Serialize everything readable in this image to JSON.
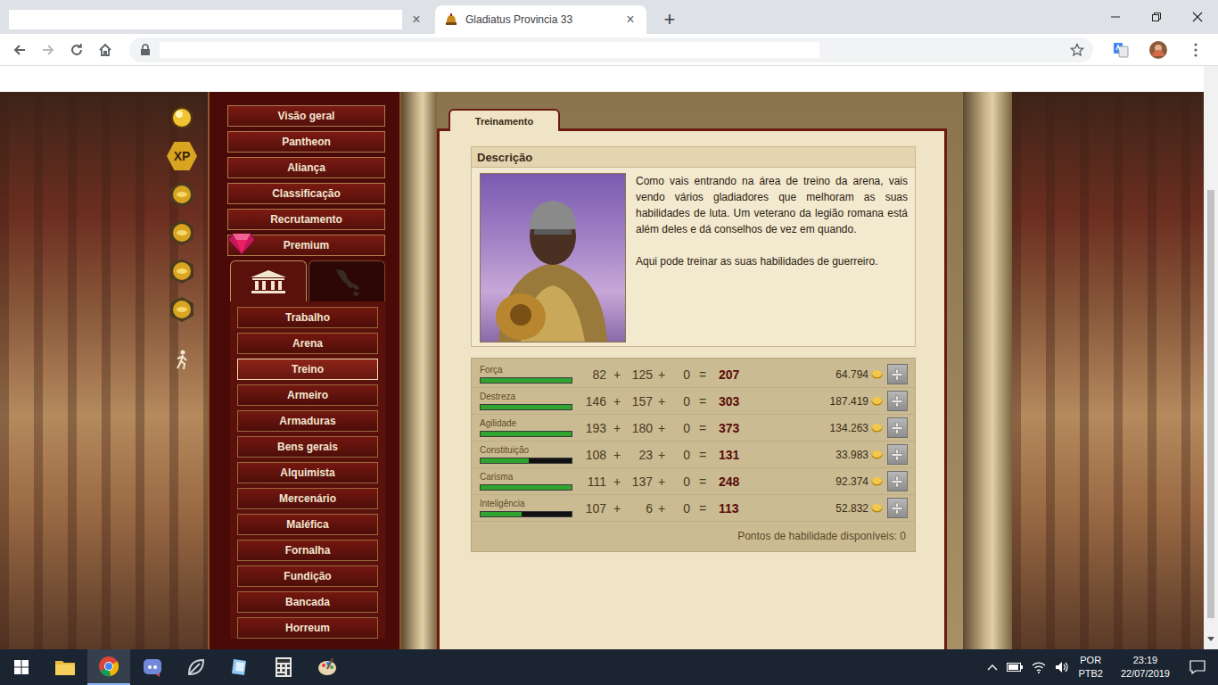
{
  "browser": {
    "tabs": [
      {
        "title": "",
        "selected": false,
        "close": "×"
      },
      {
        "title": "Gladiatus Provincia 33",
        "selected": true,
        "close": "×"
      }
    ],
    "new_tab": "+",
    "address": {
      "url": ""
    }
  },
  "game": {
    "side_icons": [
      {
        "kind": "orb",
        "label": ""
      },
      {
        "kind": "xp",
        "label": "XP"
      },
      {
        "kind": "coin",
        "label": ""
      },
      {
        "kind": "coin",
        "label": ""
      },
      {
        "kind": "coin",
        "label": ""
      },
      {
        "kind": "coin",
        "label": ""
      },
      {
        "kind": "walker",
        "label": ""
      }
    ],
    "menu": [
      {
        "label": "Visão geral",
        "kind": "link",
        "selected": false
      },
      {
        "label": "Pantheon",
        "kind": "link",
        "selected": false
      },
      {
        "label": "Aliança",
        "kind": "link",
        "selected": false
      },
      {
        "label": "Classificação",
        "kind": "link",
        "selected": false
      },
      {
        "label": "Recrutamento",
        "kind": "link",
        "selected": false
      },
      {
        "label": "Premium",
        "kind": "premium",
        "selected": false
      }
    ],
    "section_tabs": [
      {
        "kind": "city",
        "selected": true
      },
      {
        "kind": "map",
        "selected": false
      }
    ],
    "sub_menu": [
      {
        "label": "Trabalho",
        "selected": false
      },
      {
        "label": "Arena",
        "selected": false
      },
      {
        "label": "Treino",
        "selected": true
      },
      {
        "label": "Armeiro",
        "selected": false
      },
      {
        "label": "Armaduras",
        "selected": false
      },
      {
        "label": "Bens gerais",
        "selected": false
      },
      {
        "label": "Alquimista",
        "selected": false
      },
      {
        "label": "Mercenário",
        "selected": false
      },
      {
        "label": "Maléfica",
        "selected": false
      },
      {
        "label": "Fornalha",
        "selected": false
      },
      {
        "label": "Fundição",
        "selected": false
      },
      {
        "label": "Bancada",
        "selected": false
      },
      {
        "label": "Horreum",
        "selected": false
      }
    ],
    "panel": {
      "tab": "Treinamento",
      "description": {
        "title": "Descrição",
        "paragraphs": [
          "Como vais entrando na área de treino da arena, vais vendo vários gladiadores que melhoram as suas habilidades de luta. Um veterano da legião romana está além deles e dá conselhos de vez em quando.",
          "Aqui pode treinar as suas habilidades de guerreiro."
        ]
      },
      "operators": {
        "plus": "+",
        "equals": "="
      },
      "stats": [
        {
          "name": "Força",
          "base": "82",
          "bonus": "125",
          "extra": "0",
          "total": "207",
          "cost": "64.794",
          "level": 1
        },
        {
          "name": "Destreza",
          "base": "146",
          "bonus": "157",
          "extra": "0",
          "total": "303",
          "cost": "187.419",
          "level": 1
        },
        {
          "name": "Agilidade",
          "base": "193",
          "bonus": "180",
          "extra": "0",
          "total": "373",
          "cost": "134.263",
          "level": 1
        },
        {
          "name": "Constituição",
          "base": "108",
          "bonus": "23",
          "extra": "0",
          "total": "131",
          "cost": "33.983",
          "level": 0.53
        },
        {
          "name": "Carisma",
          "base": "111",
          "bonus": "137",
          "extra": "0",
          "total": "248",
          "cost": "92.374",
          "level": 1
        },
        {
          "name": "Inteligência",
          "base": "107",
          "bonus": "6",
          "extra": "0",
          "total": "113",
          "cost": "52.832",
          "level": 0.45
        }
      ],
      "footer": "Pontos de habilidade disponíveis: 0"
    }
  },
  "taskbar": {
    "apps": [
      {
        "kind": "folder",
        "selected": false
      },
      {
        "kind": "chrome",
        "selected": true
      },
      {
        "kind": "discord",
        "selected": false
      },
      {
        "kind": "leaf",
        "selected": false
      },
      {
        "kind": "notes",
        "selected": false
      },
      {
        "kind": "calculator",
        "selected": false
      },
      {
        "kind": "paint",
        "selected": false
      }
    ],
    "tray": {
      "language": "POR",
      "layout": "PTB2",
      "time": "23:19",
      "date": "22/07/2019"
    }
  }
}
